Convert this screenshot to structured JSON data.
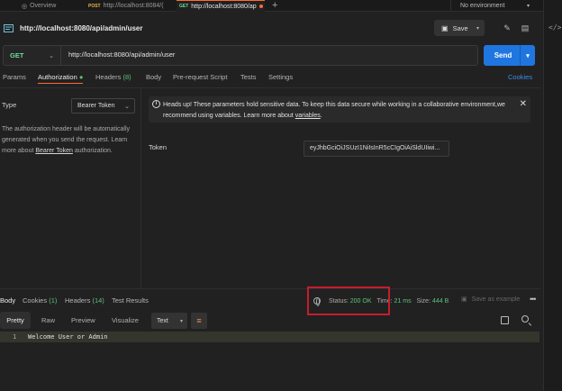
{
  "tabs": [
    {
      "method": "",
      "label": "Overview"
    },
    {
      "method": "POST",
      "label": "http://localhost:8084/("
    },
    {
      "method": "GET",
      "label": "http://localhost:8080/ap"
    }
  ],
  "environment": "No environment",
  "request": {
    "title": "http://localhost:8080/api/admin/user",
    "save_label": "Save",
    "method": "GET",
    "url": "http://localhost:8080/api/admin/user",
    "send_label": "Send"
  },
  "request_tabs": {
    "params": "Params",
    "authorization": "Authorization",
    "headers": "Headers",
    "headers_count": "(8)",
    "body": "Body",
    "prerequest": "Pre-request Script",
    "tests": "Tests",
    "settings": "Settings",
    "cookies": "Cookies"
  },
  "auth": {
    "type_label": "Type",
    "type_value": "Bearer Token",
    "description_1": "The authorization header will be automatically generated when you send the request. Learn more about",
    "description_link": "Bearer Token",
    "description_2": "authorization.",
    "notice_1": "Heads up! These parameters hold sensitive data. To keep this data secure while working in a collaborative environment,we recommend using variables. Learn more about",
    "notice_link": "variables",
    "notice_end": ".",
    "token_label": "Token",
    "token_value": "eyJhbGciOiJSUzI1NiIsInR5cCIgOiAiSldUIiwi..."
  },
  "response": {
    "tabs": {
      "body": "Body",
      "cookies": "Cookies",
      "cookies_count": "(1)",
      "headers": "Headers",
      "headers_count": "(14)",
      "test_results": "Test Results"
    },
    "status_label": "Status:",
    "status_value": "200 OK",
    "time_label": "Time:",
    "time_value": "21 ms",
    "size_label": "Size:",
    "size_value": "444 B",
    "save_example": "Save as example",
    "formats": [
      "Pretty",
      "Raw",
      "Preview",
      "Visualize"
    ],
    "content_type": "Text",
    "lines": [
      {
        "number": "1",
        "text": "Welcome User or Admin"
      }
    ]
  },
  "colors": {
    "accent": "#ff6c37",
    "send": "#1f76e0",
    "success": "#5ec27c",
    "highlight": "#c41e2b"
  }
}
